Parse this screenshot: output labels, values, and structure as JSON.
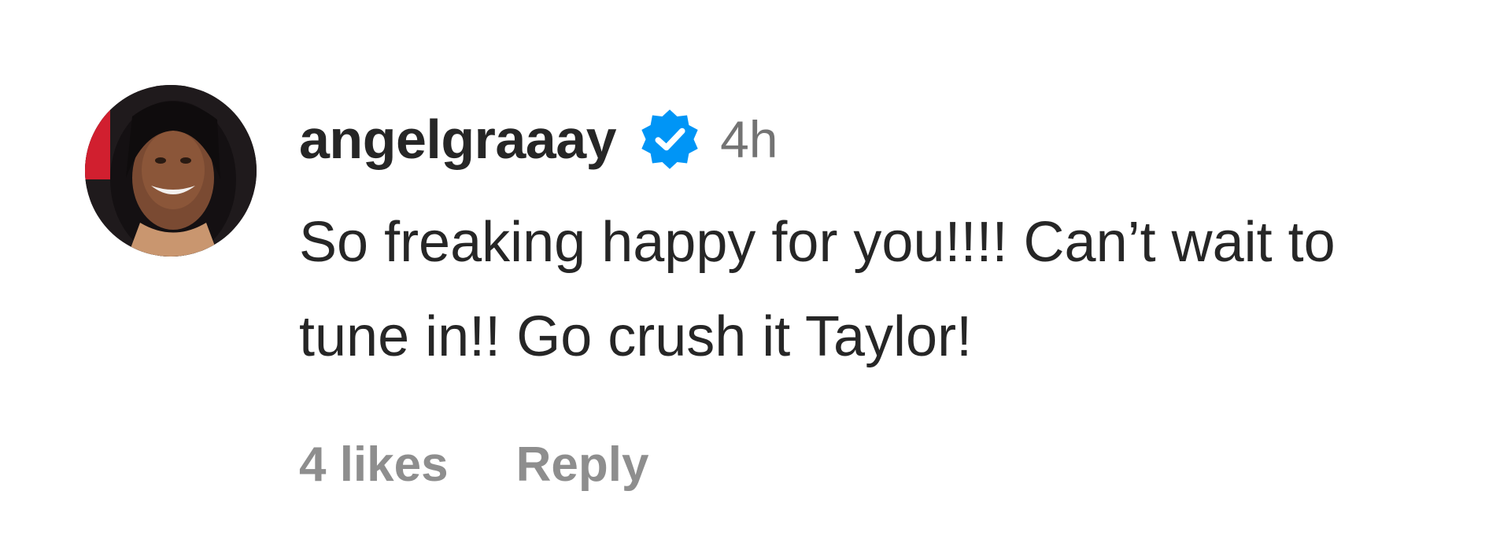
{
  "comment": {
    "username": "angelgraaay",
    "verified_icon": "verified-badge-icon",
    "timestamp": "4h",
    "text": "So freaking happy for you!!!! Can’t wait to tune in!! Go crush it Taylor!",
    "likes": "4 likes",
    "reply_label": "Reply"
  },
  "colors": {
    "username": "#262626",
    "text": "#262626",
    "meta": "#737373",
    "verified": "#0095f6"
  }
}
